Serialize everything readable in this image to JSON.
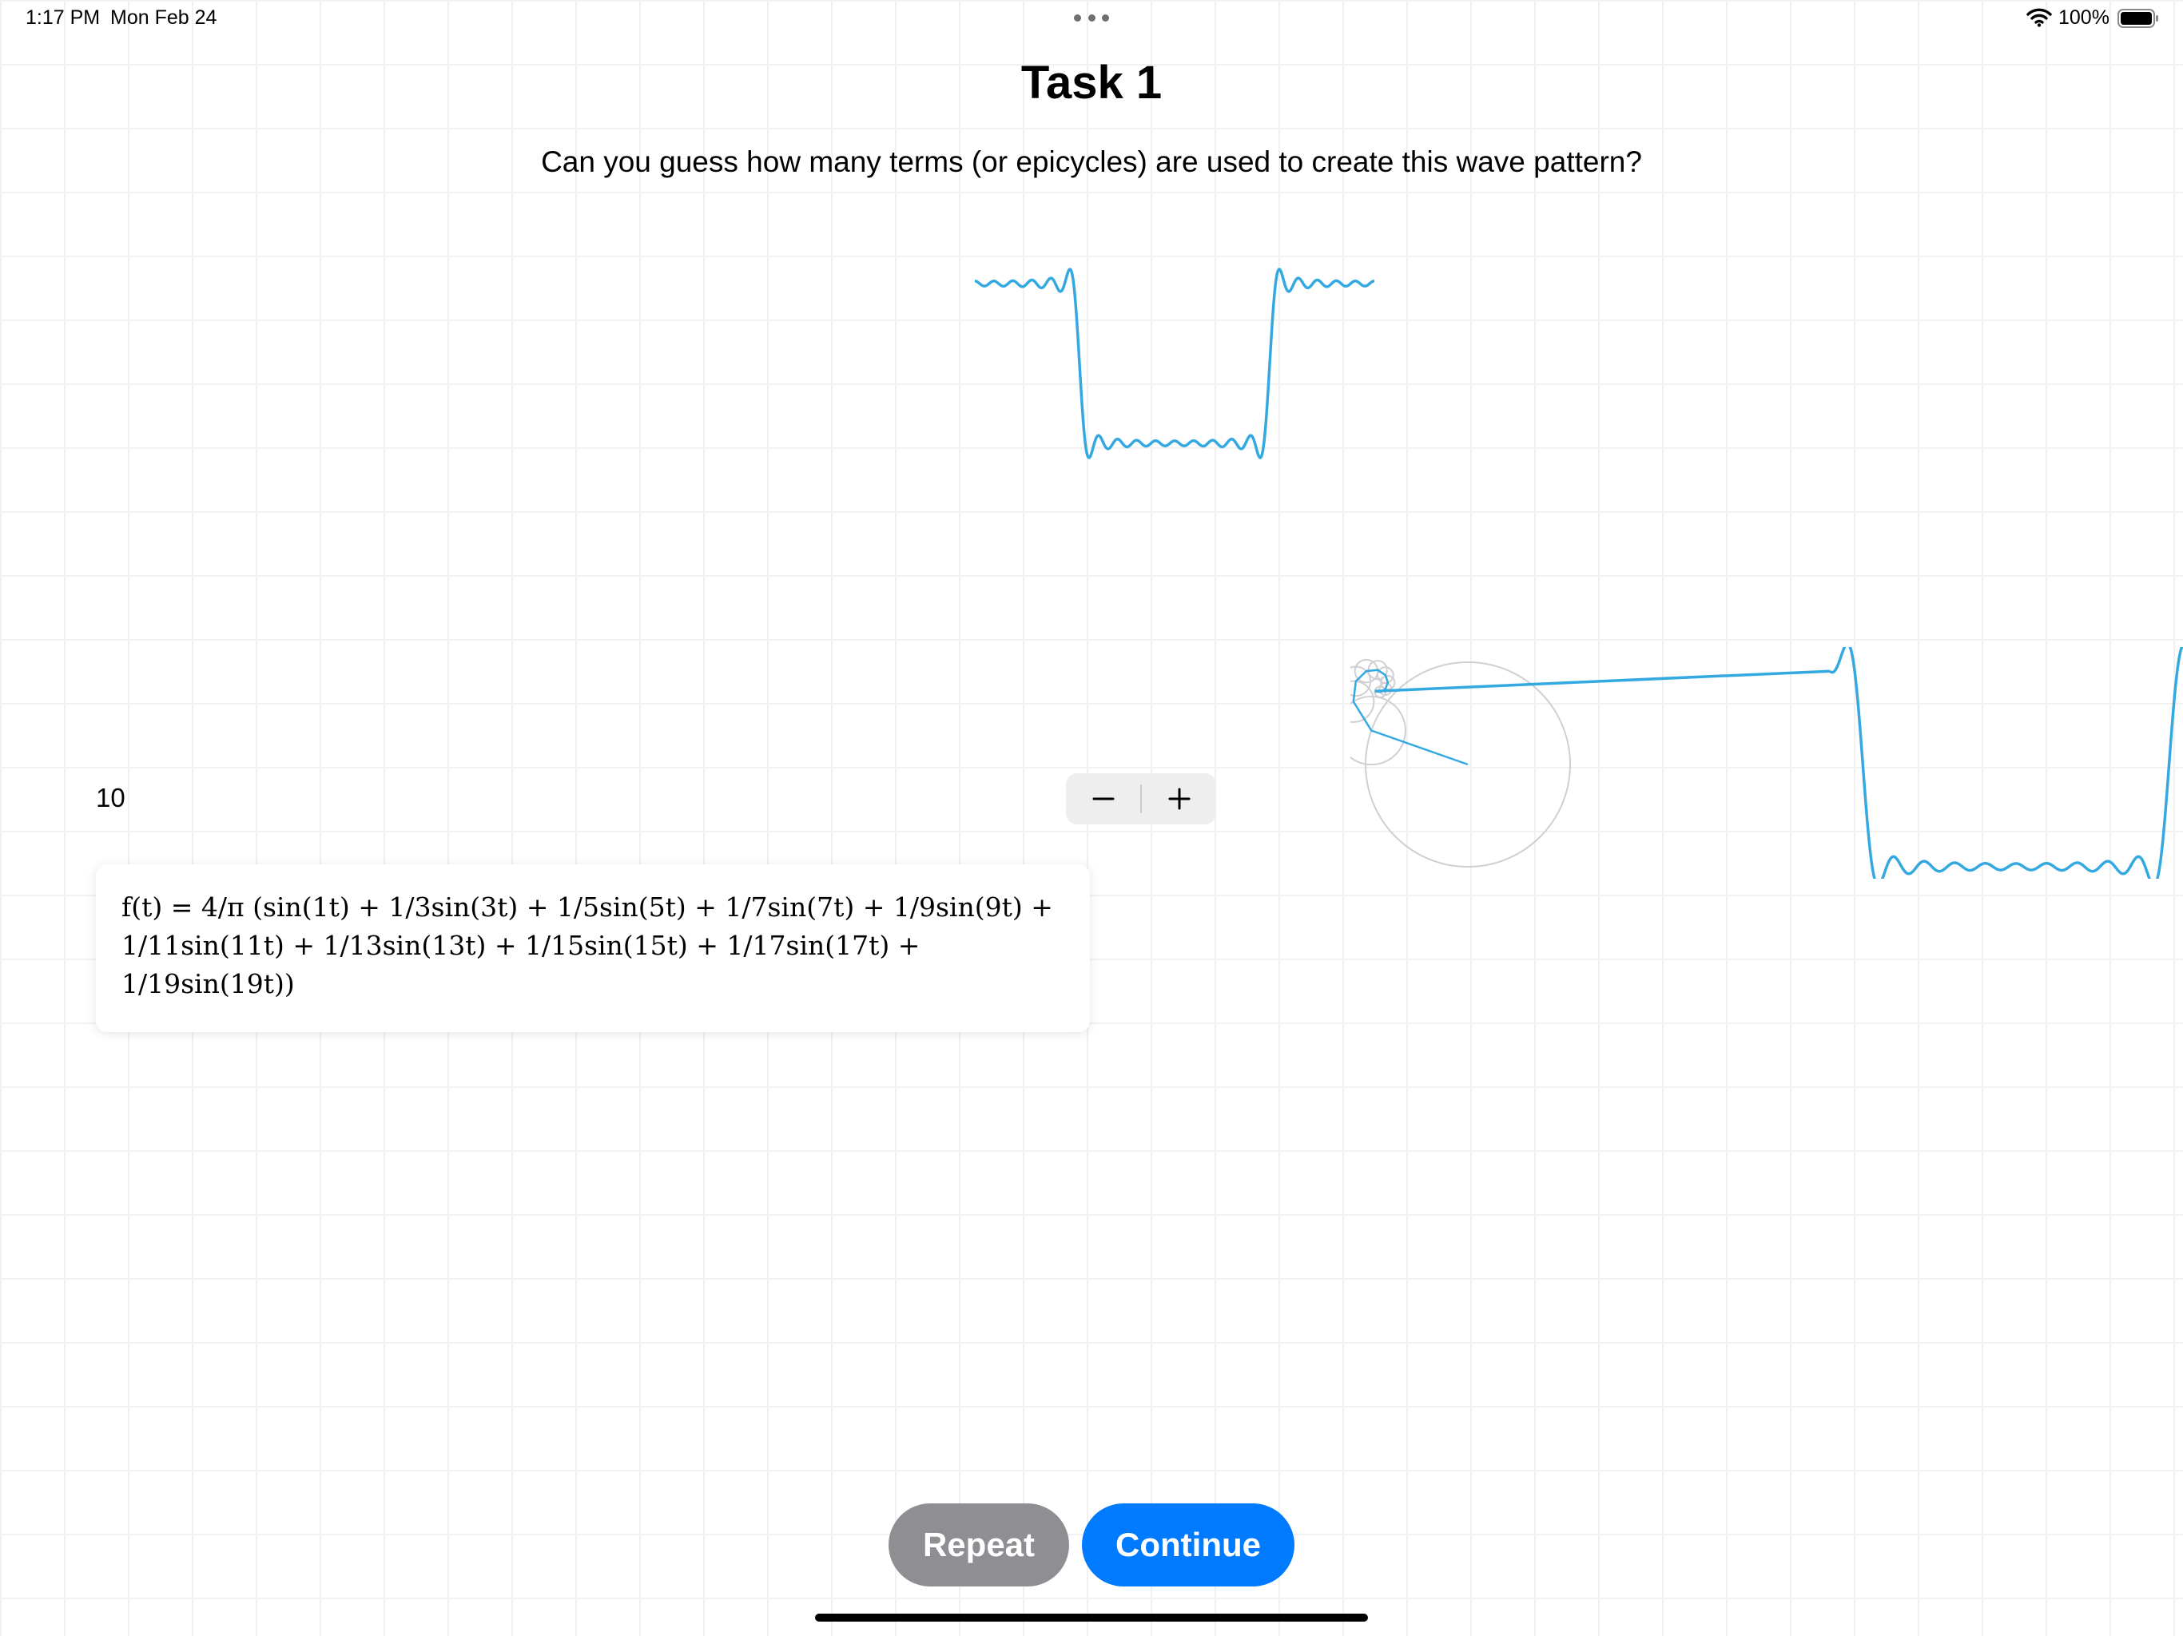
{
  "status_bar": {
    "time": "1:17 PM",
    "date": "Mon Feb 24",
    "battery_percent": "100%"
  },
  "header": {
    "title": "Task 1",
    "question": "Can you guess how many terms (or epicycles) are used to create this wave pattern?"
  },
  "wave": {
    "color": "#34a9e1",
    "target_terms": 10
  },
  "terms": {
    "value": "10",
    "decrement_icon": "minus-icon",
    "increment_icon": "plus-icon"
  },
  "formula": {
    "text": "f(t) = 4/π (sin(1t) + 1/3sin(3t) + 1/5sin(5t) + 1/7sin(7t) + 1/9sin(9t) + 1/11sin(11t) + 1/13sin(13t) + 1/15sin(15t) + 1/17sin(17t) + 1/19sin(19t))"
  },
  "buttons": {
    "repeat": "Repeat",
    "continue": "Continue"
  },
  "colors": {
    "accent": "#007aff",
    "secondary_button": "#8e8e93",
    "wave": "#34a9e1"
  }
}
